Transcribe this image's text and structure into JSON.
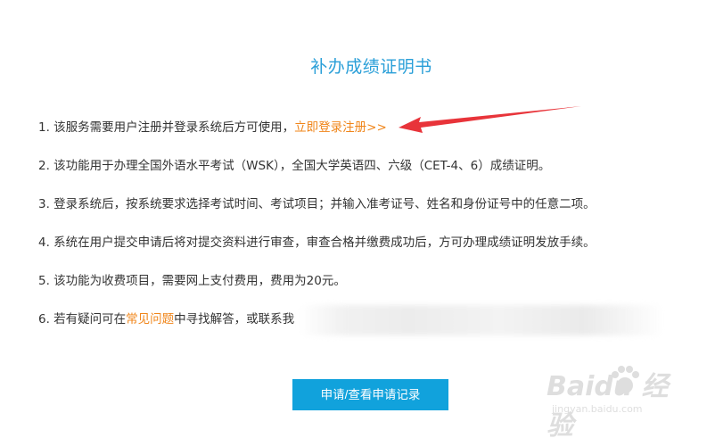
{
  "page": {
    "title": "补办成绩证明书"
  },
  "instructions": [
    {
      "text": "1. 该服务需要用户注册并登录系统后方可使用，",
      "link": "立即登录注册>>"
    },
    {
      "text": "2. 该功能用于办理全国外语水平考试（WSK），全国大学英语四、六级（CET-4、6）成绩证明。"
    },
    {
      "text": "3. 登录系统后，按系统要求选择考试时间、考试项目；并输入准考证号、姓名和身份证号中的任意二项。"
    },
    {
      "text": "4. 系统在用户提交申请后将对提交资料进行审查，审查合格并缴费成功后，方可办理成绩证明发放手续。"
    },
    {
      "text": "5. 该功能为收费项目，需要网上支付费用，费用为20元。"
    },
    {
      "prefix": "6. 若有疑问可在",
      "link": "常见问题",
      "suffix": "中寻找解答，或联系我"
    }
  ],
  "button": {
    "label": "申请/查看申请记录"
  },
  "watermark": {
    "main": "Baidu 经验",
    "sub": "jingyan.baidu.com"
  },
  "colors": {
    "title": "#2a9fd8",
    "link": "#f08519",
    "button": "#11a2dc",
    "arrow": "#e8343a"
  }
}
